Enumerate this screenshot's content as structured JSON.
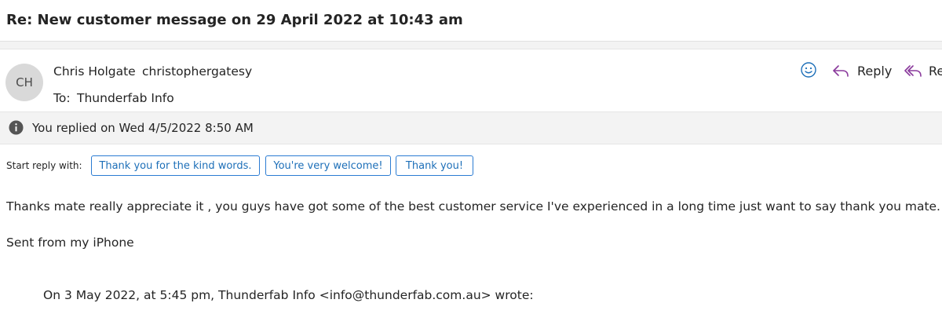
{
  "message": {
    "subject": "Re: New customer message on 29 April 2022 at 10:43 am",
    "sender": {
      "initials": "CH",
      "name": "Chris Holgate",
      "address": "christophergatesy"
    },
    "to": {
      "label": "To:",
      "value": "Thunderfab Info"
    },
    "actions": {
      "emoji_icon": "smiley-icon",
      "reply_label": "Reply",
      "reply_all_label": "Re"
    },
    "info_bar": {
      "icon": "info-icon",
      "text": "You replied on Wed 4/5/2022 8:50 AM"
    },
    "suggested_replies": {
      "label": "Start reply with:",
      "options": [
        "Thank you for the kind words.",
        "You're very welcome!",
        "Thank you!"
      ]
    },
    "body": {
      "line1": "Thanks mate really appreciate it , you guys have got some of the best customer service I've experienced in a long time just want to say thank you mate.",
      "signature": "Sent from my iPhone",
      "quote_header": "On 3 May 2022, at 5:45 pm, Thunderfab Info <info@thunderfab.com.au> wrote:"
    }
  },
  "colors": {
    "accent": "#2b7cd3",
    "suggest_text": "#1d6fb8",
    "reply_icon": "#8a3a9c",
    "emoji_icon": "#1d6fb8",
    "avatar_bg": "#d9d9d9",
    "bar_bg": "#f3f3f3"
  }
}
